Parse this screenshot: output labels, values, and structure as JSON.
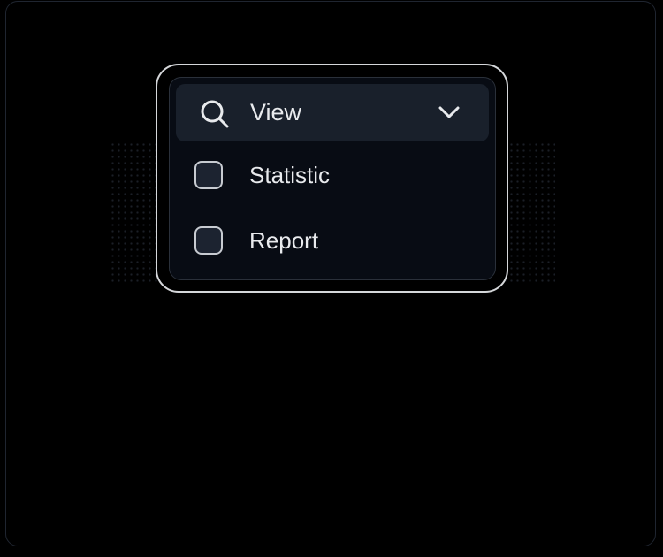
{
  "dropdown": {
    "label": "View",
    "icon": "search-icon",
    "expand_icon": "chevron-down-icon",
    "options": [
      {
        "label": "Statistic",
        "checked": false
      },
      {
        "label": "Report",
        "checked": false
      }
    ]
  },
  "colors": {
    "background": "#000000",
    "panel": "#080c14",
    "header": "#19202b",
    "text": "#e8eaed",
    "ring": "#d5d7da",
    "checkbox_fill": "#1c2330",
    "checkbox_border": "#c7cbd1"
  }
}
